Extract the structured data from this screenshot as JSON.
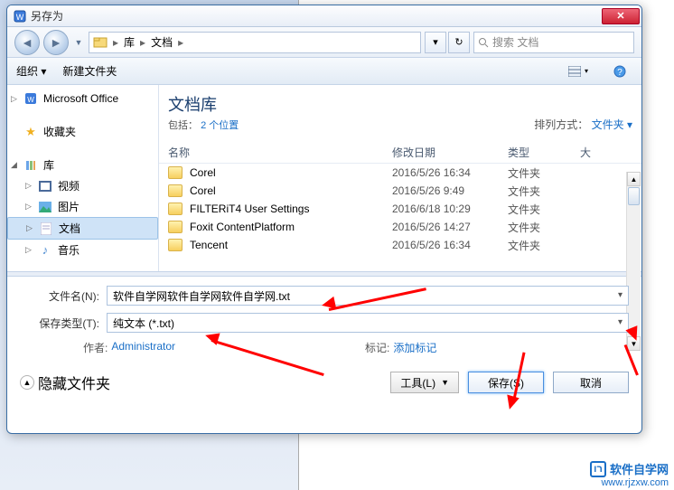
{
  "title": "另存为",
  "nav": {
    "path1": "库",
    "path2": "文档",
    "search_placeholder": "搜索 文档"
  },
  "toolbar": {
    "organize": "组织 ▾",
    "newfolder": "新建文件夹"
  },
  "sidebar": {
    "office": "Microsoft Office",
    "fav": "收藏夹",
    "lib": "库",
    "video": "视频",
    "pictures": "图片",
    "docs": "文档",
    "music": "音乐"
  },
  "library": {
    "title": "文档库",
    "subtitle_prefix": "包括：",
    "subtitle_link": "2 个位置",
    "arrange_label": "排列方式：",
    "arrange_value": "文件夹 ▾"
  },
  "columns": {
    "name": "名称",
    "date": "修改日期",
    "type": "类型",
    "size": "大"
  },
  "rows": [
    {
      "name": "Corel",
      "date": "2016/5/26 16:34",
      "type": "文件夹"
    },
    {
      "name": "Corel",
      "date": "2016/5/26 9:49",
      "type": "文件夹"
    },
    {
      "name": "FILTERiT4 User Settings",
      "date": "2016/6/18 10:29",
      "type": "文件夹"
    },
    {
      "name": "Foxit ContentPlatform",
      "date": "2016/5/26 14:27",
      "type": "文件夹"
    },
    {
      "name": "Tencent",
      "date": "2016/5/26 16:34",
      "type": "文件夹"
    }
  ],
  "form": {
    "filename_label": "文件名(N):",
    "filename_value": "软件自学网软件自学网软件自学网.txt",
    "type_label": "保存类型(T):",
    "type_value": "纯文本 (*.txt)",
    "author_label": "作者:",
    "author_value": "Administrator",
    "tags_label": "标记:",
    "tags_value": "添加标记"
  },
  "footer": {
    "hide": "隐藏文件夹",
    "tools": "工具(L)",
    "save": "保存(S)",
    "cancel": "取消"
  },
  "watermark": {
    "text": "软件自学网",
    "url": "www.rjzxw.com"
  }
}
